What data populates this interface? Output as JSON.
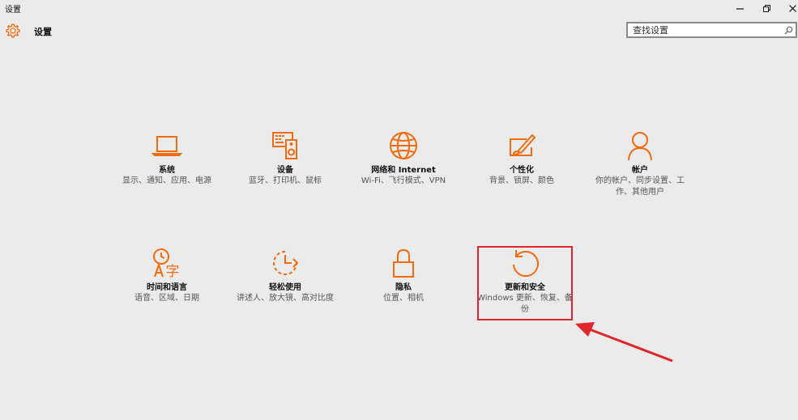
{
  "window": {
    "title": "设置",
    "controls": [
      "minimize-icon",
      "restore-icon",
      "close-icon"
    ]
  },
  "header": {
    "app_icon": "gear-icon",
    "title": "设置",
    "search": {
      "placeholder": "查找设置",
      "icon": "search-icon"
    }
  },
  "accent": "#f26b0f",
  "tiles": [
    {
      "name": "系统",
      "desc": "显示、通知、应用、电源",
      "icon": "laptop-icon"
    },
    {
      "name": "设备",
      "desc": "蓝牙、打印机、鼠标",
      "icon": "devices-icon"
    },
    {
      "name": "网络和 Internet",
      "desc": "Wi-Fi、飞行模式、VPN",
      "icon": "globe-icon"
    },
    {
      "name": "个性化",
      "desc": "背景、锁屏、颜色",
      "icon": "paint-brush-icon"
    },
    {
      "name": "帐户",
      "desc": "你的帐户、同步设置、工作、其他用户",
      "icon": "person-icon"
    },
    {
      "name": "时间和语言",
      "desc": "语音、区域、日期",
      "icon": "time-language-icon"
    },
    {
      "name": "轻松使用",
      "desc": "讲述人、放大镜、高对比度",
      "icon": "ease-of-access-icon"
    },
    {
      "name": "隐私",
      "desc": "位置、相机",
      "icon": "lock-icon"
    },
    {
      "name": "更新和安全",
      "desc": "Windows 更新、恢复、备份",
      "icon": "update-icon"
    }
  ],
  "annotation": {
    "highlight_color": "#e0262a"
  }
}
